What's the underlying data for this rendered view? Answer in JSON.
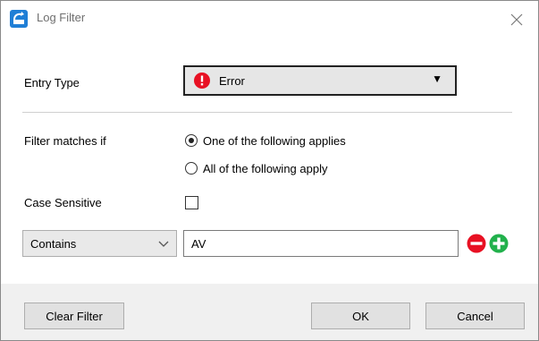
{
  "window": {
    "title": "Log Filter",
    "app_icon": "log-filter-app-icon",
    "close_icon": "close-icon"
  },
  "entry_type": {
    "label": "Entry Type",
    "value": "Error",
    "icon": "error-icon",
    "icon_color": "#e81123"
  },
  "filter_match": {
    "label": "Filter matches if",
    "options": [
      {
        "label": "One of the following applies",
        "checked": true
      },
      {
        "label": "All of the following apply",
        "checked": false
      }
    ]
  },
  "case_sensitive": {
    "label": "Case Sensitive",
    "checked": false
  },
  "condition_row": {
    "operator": "Contains",
    "value": "AV",
    "remove_color": "#e81123",
    "add_color": "#22b14c"
  },
  "buttons": {
    "clear_filter": "Clear Filter",
    "ok": "OK",
    "cancel": "Cancel"
  }
}
